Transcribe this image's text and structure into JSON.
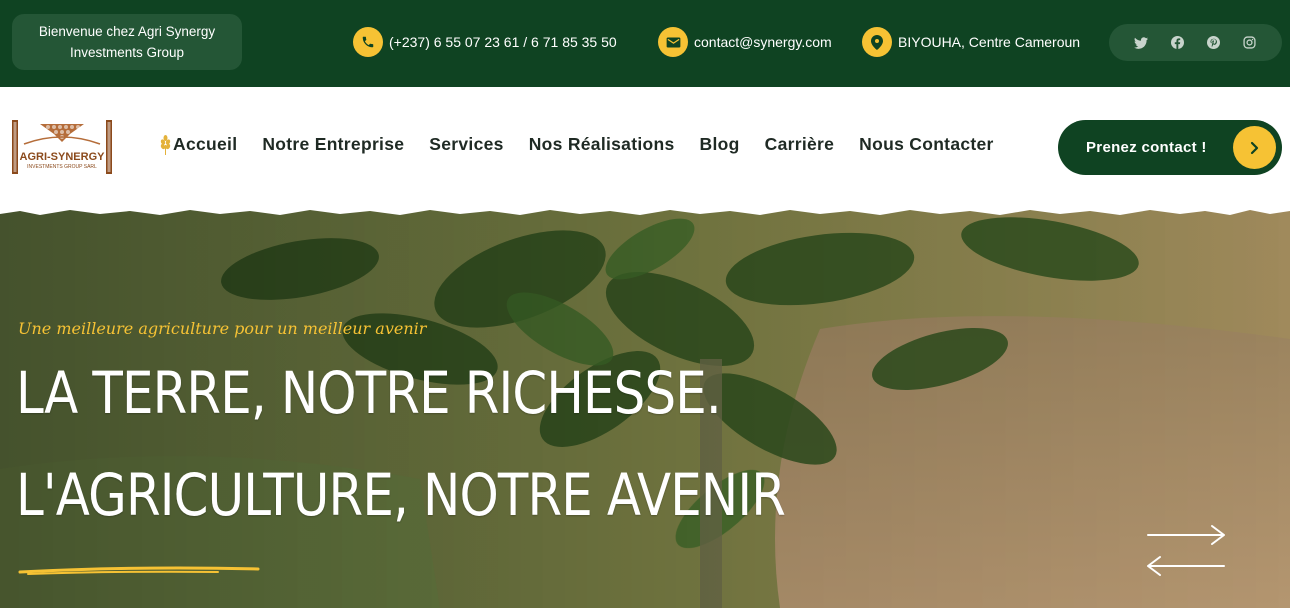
{
  "topbar": {
    "welcome": "Bienvenue chez Agri Synergy Investments Group",
    "phone": {
      "icon": "phone-icon",
      "text": "(+237) 6 55 07 23 61 / 6 71 85 35 50"
    },
    "email": {
      "icon": "mail-icon",
      "text": "contact@synergy.com"
    },
    "location": {
      "icon": "location-pin-icon",
      "text": "BIYOUHA, Centre Cameroun"
    },
    "socials": [
      "twitter-icon",
      "facebook-icon",
      "pinterest-icon",
      "instagram-icon"
    ]
  },
  "logo": {
    "line1": "AGRI-SYNERGY",
    "line2": "INVESTMENTS GROUP SARL"
  },
  "nav": {
    "items": [
      {
        "label": "Accueil",
        "active": true,
        "icon": "wheat-icon"
      },
      {
        "label": "Notre Entreprise"
      },
      {
        "label": "Services"
      },
      {
        "label": "Nos Réalisations"
      },
      {
        "label": "Blog"
      },
      {
        "label": "Carrière"
      },
      {
        "label": "Nous Contacter"
      }
    ],
    "cta_label": "Prenez contact !"
  },
  "hero": {
    "tagline": "Une meilleure agriculture pour un meilleur avenir",
    "headline_line1": "LA TERRE, NOTRE RICHESSE.",
    "headline_line2": "L'AGRICULTURE, NOTRE AVENIR",
    "slider_next": "arrow-right-icon",
    "slider_prev": "arrow-left-icon"
  },
  "colors": {
    "primary_green": "#0f4322",
    "accent_yellow": "#f6c234",
    "logo_brown": "#8b4a1c"
  }
}
